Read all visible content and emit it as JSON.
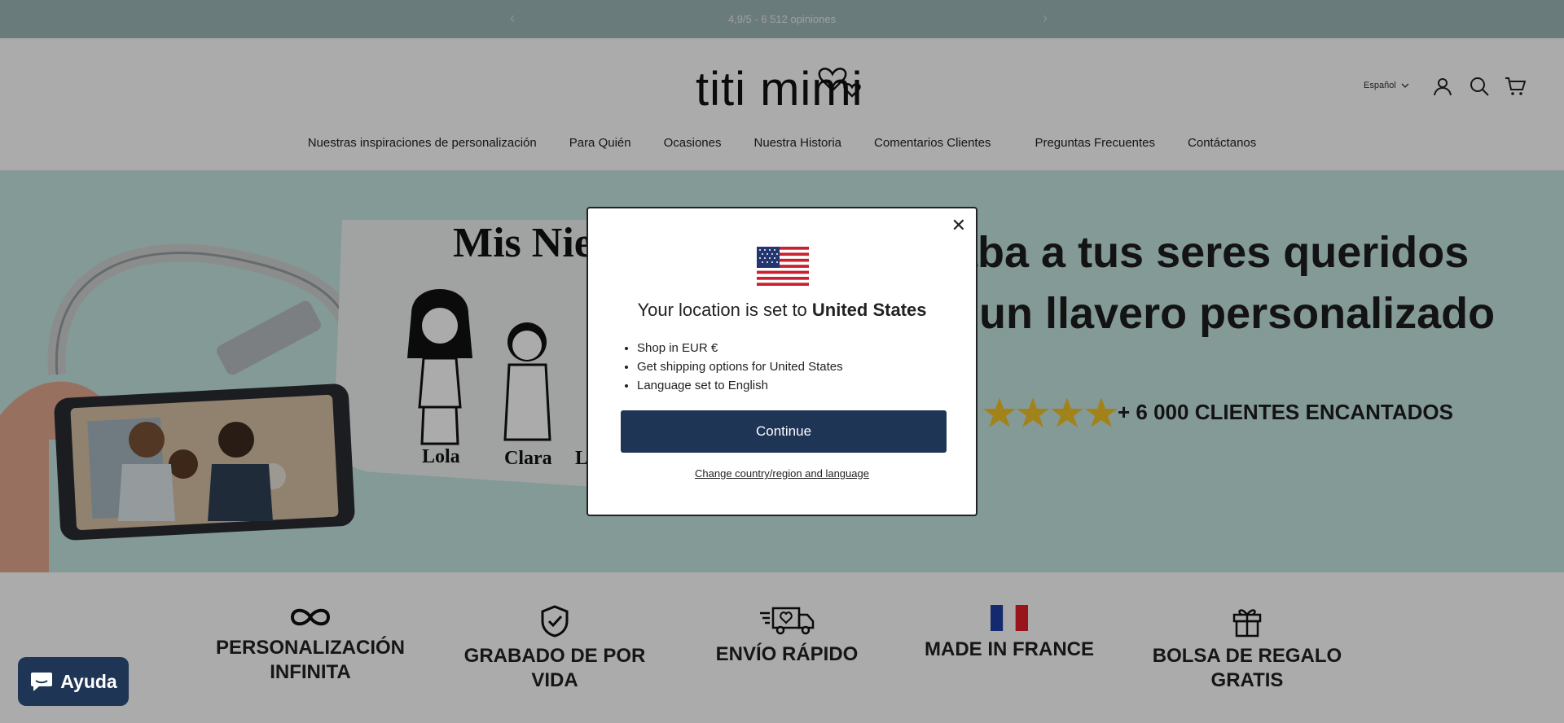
{
  "topbar": {
    "announcement": "4,9/5 - 6 512 opiniones",
    "prev_icon": "chevron-left-icon",
    "next_icon": "chevron-right-icon"
  },
  "header": {
    "logo_text": "titi mimi",
    "language": "Español",
    "icons": [
      "account-icon",
      "search-icon",
      "cart-icon"
    ]
  },
  "nav": {
    "items": [
      "Nuestras inspiraciones de personalización",
      "Para Quién",
      "Ocasiones",
      "Nuestra Historia",
      "Comentarios Clientes",
      "Preguntas Frecuentes",
      "Contáctanos"
    ]
  },
  "hero": {
    "keychain_title": "Mis Nie",
    "names": [
      "Lola",
      "Clara",
      "L"
    ],
    "headline_line1": "aba a tus seres queridos",
    "headline_line2": "un llavero personalizado",
    "rating_text": "+ 6 000 CLIENTES ENCANTADOS",
    "stars": 4
  },
  "features": [
    {
      "icon": "infinity-icon",
      "label": "PERSONALIZACIÓN INFINITA"
    },
    {
      "icon": "shield-check-icon",
      "label": "GRABADO DE POR VIDA"
    },
    {
      "icon": "delivery-truck-icon",
      "label": "ENVÍO RÁPIDO"
    },
    {
      "icon": "france-flag-icon",
      "label": "MADE IN FRANCE"
    },
    {
      "icon": "gift-icon",
      "label": "BOLSA DE REGALO GRATIS"
    }
  ],
  "modal": {
    "title_prefix": "Your location is set to",
    "title_country": "United States",
    "bullets": [
      "Shop in EUR €",
      "Get shipping options for United States",
      "Language set to English"
    ],
    "continue_label": "Continue",
    "change_link": "Change country/region and language",
    "close_icon": "close-icon",
    "flag_icon": "us-flag-icon"
  },
  "chat": {
    "label": "Ayuda",
    "icon": "chat-bubble-icon"
  },
  "colors": {
    "topbar": "#9fb8b8",
    "hero_bg": "#c5e6e1",
    "button": "#1e3556",
    "star": "#f2c229"
  }
}
